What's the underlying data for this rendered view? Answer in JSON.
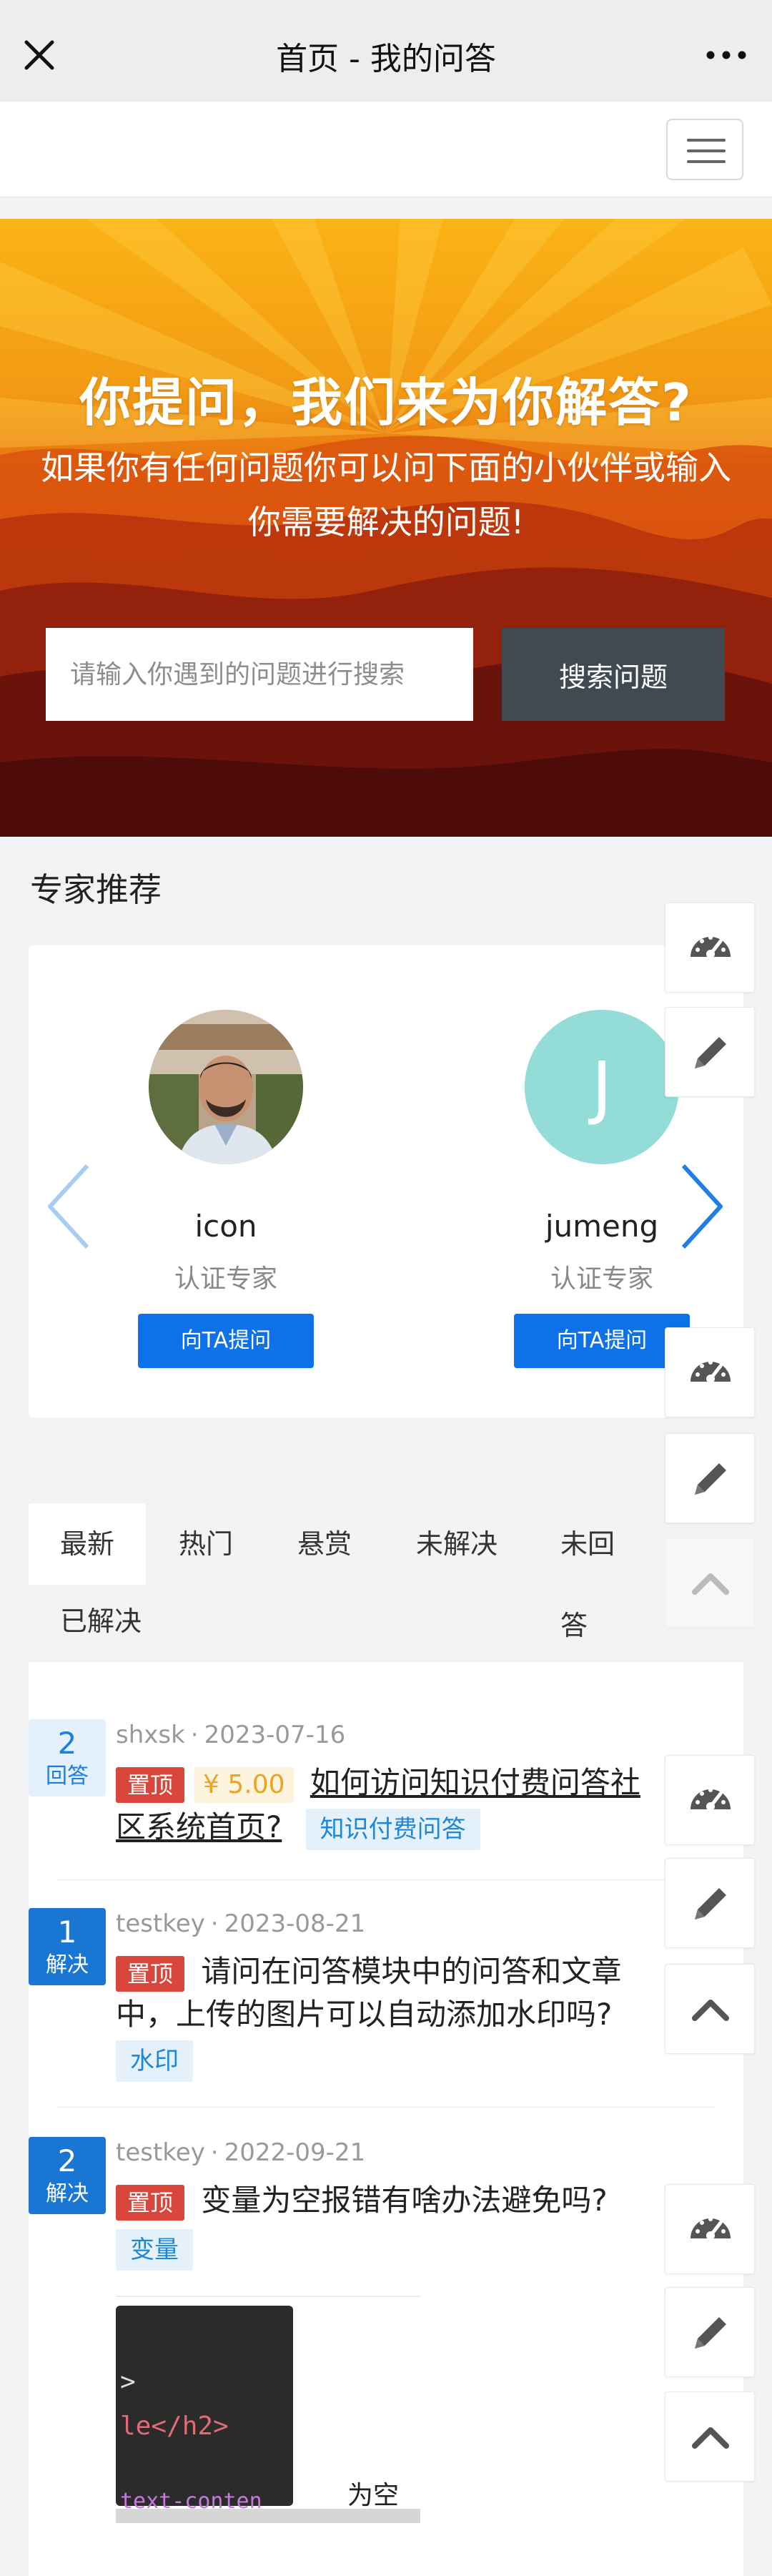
{
  "titlebar": {
    "title": "首页 - 我的问答"
  },
  "hero": {
    "heading": "你提问，我们来为你解答?",
    "description": "如果你有任何问题你可以问下面的小伙伴或输入你需要解决的问题!",
    "search_placeholder": "请输入你遇到的问题进行搜索",
    "search_button": "搜索问题"
  },
  "experts_section": {
    "title": "专家推荐",
    "experts": [
      {
        "name": "icon",
        "role": "认证专家",
        "ask_label": "向TA提问"
      },
      {
        "name": "jumeng",
        "role": "认证专家",
        "ask_label": "向TA提问",
        "avatar_letter": "J"
      }
    ]
  },
  "tabs": [
    "最新",
    "热门",
    "悬赏",
    "未解决",
    "未回答",
    "已解决"
  ],
  "questions": [
    {
      "count": "2",
      "count_label": "回答",
      "author": "shxsk",
      "date": "2023-07-16",
      "badge": "置顶",
      "reward": "¥ 5.00",
      "title_line1": "如何访问知识付费问答社",
      "title_line2": "区系统首页?",
      "tag": "知识付费问答"
    },
    {
      "count": "1",
      "count_label": "解决",
      "author": "testkey",
      "date": "2023-08-21",
      "badge": "置顶",
      "title_line1": "请问在问答模块中的问答和文章",
      "title_line2": "中，上传的图片可以自动添加水印吗?",
      "tag": "水印"
    },
    {
      "count": "2",
      "count_label": "解决",
      "author": "testkey",
      "date": "2022-09-21",
      "badge": "置顶",
      "title_line1": "变量为空报错有啥办法避免吗?",
      "tag": "变量",
      "thumb_caption": "为空报",
      "thumb_code": [
        ">",
        "le</h2>",
        "text-conten"
      ]
    }
  ],
  "colors": {
    "primary": "#0d72ea",
    "dark_button": "#3f4a52",
    "top_badge": "#d9463b"
  }
}
